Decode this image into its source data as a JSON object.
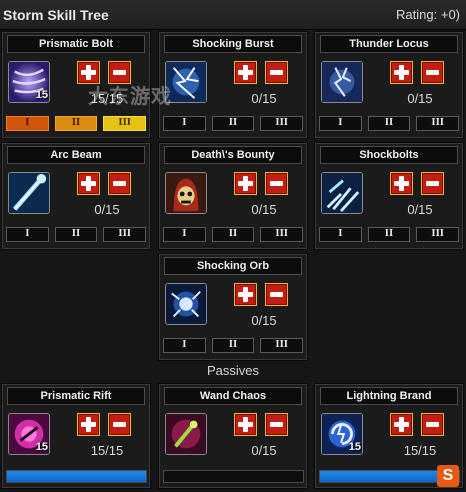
{
  "header": {
    "title": "Storm Skill Tree",
    "rating": "Rating: +0)"
  },
  "passives_label": "Passives",
  "watermark": "大东游戏",
  "corner_logo": "S",
  "colors": {
    "button_red": "#c41d12",
    "button_border": "#f0b13a",
    "progress_blue": "#1c8bea"
  },
  "tier_labels": [
    "I",
    "II",
    "III"
  ],
  "skills": [
    {
      "name": "Prismatic Bolt",
      "icon": "prismatic-bolt-icon",
      "level": "15/15",
      "badge": "15",
      "tiers_active": 3
    },
    {
      "name": "Shocking Burst",
      "icon": "shocking-burst-icon",
      "level": "0/15",
      "badge": "",
      "tiers_active": 0
    },
    {
      "name": "Thunder Locus",
      "icon": "thunder-locus-icon",
      "level": "0/15",
      "badge": "",
      "tiers_active": 0
    },
    {
      "name": "Arc Beam",
      "icon": "arc-beam-icon",
      "level": "0/15",
      "badge": "",
      "tiers_active": 0
    },
    {
      "name": "Death\\'s Bounty",
      "icon": "deaths-bounty-icon",
      "level": "0/15",
      "badge": "",
      "tiers_active": 0
    },
    {
      "name": "Shockbolts",
      "icon": "shockbolts-icon",
      "level": "0/15",
      "badge": "",
      "tiers_active": 0
    },
    {
      "name": "Shocking Orb",
      "icon": "shocking-orb-icon",
      "level": "0/15",
      "badge": "",
      "tiers_active": 0
    }
  ],
  "passives": [
    {
      "name": "Prismatic Rift",
      "icon": "prismatic-rift-icon",
      "level": "15/15",
      "badge": "15",
      "progress": 1.0
    },
    {
      "name": "Wand Chaos",
      "icon": "wand-chaos-icon",
      "level": "0/15",
      "badge": "",
      "progress": 0.0
    },
    {
      "name": "Lightning Brand",
      "icon": "lightning-brand-icon",
      "level": "15/15",
      "badge": "15",
      "progress": 1.0
    }
  ]
}
